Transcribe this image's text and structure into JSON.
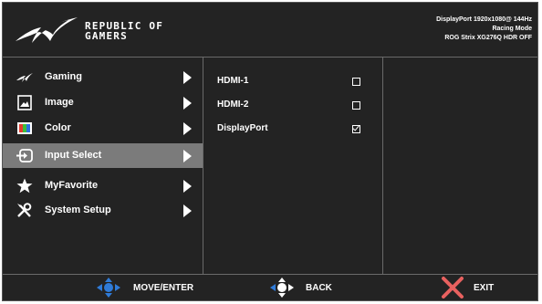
{
  "header": {
    "brand_line1": "REPUBLIC OF",
    "brand_line2": "GAMERS",
    "status_line1": "DisplayPort  1920x1080@ 144Hz",
    "status_line2": "Racing Mode",
    "status_line3": "ROG Strix XG276Q HDR OFF"
  },
  "menu": {
    "items": [
      {
        "label": "Gaming",
        "icon": "gaming-icon"
      },
      {
        "label": "Image",
        "icon": "image-icon"
      },
      {
        "label": "Color",
        "icon": "color-icon"
      },
      {
        "label": "Input Select",
        "icon": "input-select-icon",
        "selected": true
      },
      {
        "label": "MyFavorite",
        "icon": "star-icon"
      },
      {
        "label": "System Setup",
        "icon": "wrench-screwdriver-icon"
      }
    ]
  },
  "options": {
    "items": [
      {
        "label": "HDMI-1",
        "checked": false
      },
      {
        "label": "HDMI-2",
        "checked": false
      },
      {
        "label": "DisplayPort",
        "checked": true
      }
    ]
  },
  "footer": {
    "move_enter": "MOVE/ENTER",
    "back": "BACK",
    "exit": "EXIT"
  },
  "colors": {
    "background": "#232323",
    "selected_row": "#7b7b7b",
    "joystick_blue": "#2f7bd8",
    "exit_red": "#e8615f"
  }
}
